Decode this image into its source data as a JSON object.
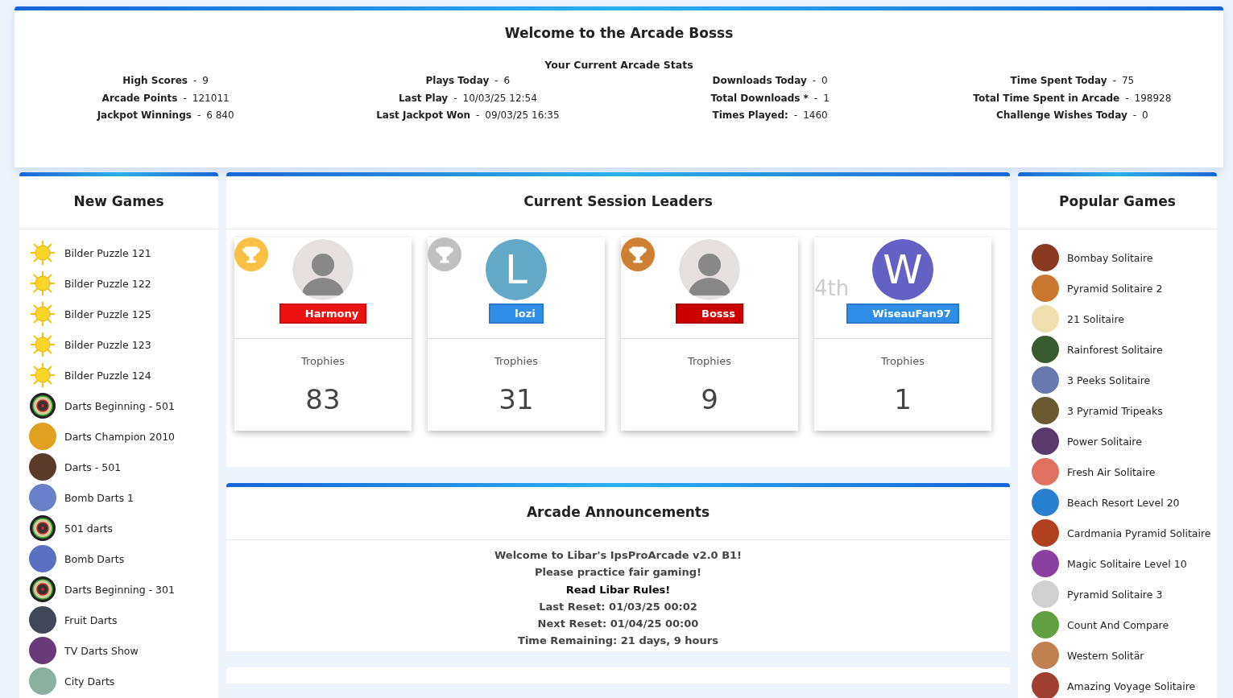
{
  "header": {
    "title": "Welcome to the Arcade Bosss",
    "subtitle": "Your Current Arcade Stats",
    "separator": "-",
    "columns": [
      [
        {
          "label": "High Scores",
          "value": "9"
        },
        {
          "label": "Arcade Points",
          "value": "121011"
        },
        {
          "label": "Jackpot Winnings",
          "value": "6 840"
        }
      ],
      [
        {
          "label": "Plays Today",
          "value": "6"
        },
        {
          "label": "Last Play",
          "value": "10/03/25 12:54"
        },
        {
          "label": "Last Jackpot Won",
          "value": "09/03/25 16:35"
        }
      ],
      [
        {
          "label": "Downloads Today",
          "value": "0"
        },
        {
          "label": "Total Downloads *",
          "value": "1"
        },
        {
          "label": "Times Played:",
          "value": "1460"
        }
      ],
      [
        {
          "label": "Time Spent Today",
          "value": "75"
        },
        {
          "label": "Total Time Spent in Arcade",
          "value": "198928"
        },
        {
          "label": "Challenge Wishes Today",
          "value": "0"
        }
      ]
    ]
  },
  "new_games": {
    "title": "New Games",
    "items": [
      {
        "name": "Bilder Puzzle 121",
        "kind": "sun"
      },
      {
        "name": "Bilder Puzzle 122",
        "kind": "sun"
      },
      {
        "name": "Bilder Puzzle 125",
        "kind": "sun"
      },
      {
        "name": "Bilder Puzzle 123",
        "kind": "sun"
      },
      {
        "name": "Bilder Puzzle 124",
        "kind": "sun"
      },
      {
        "name": "Darts Beginning - 501",
        "kind": "dartboard"
      },
      {
        "name": "Darts Champion 2010",
        "kind": "picture",
        "color": "#e0a020"
      },
      {
        "name": "Darts - 501",
        "kind": "picture",
        "color": "#5a3a2a"
      },
      {
        "name": "Bomb Darts 1",
        "kind": "picture",
        "color": "#6a80c8"
      },
      {
        "name": "501 darts",
        "kind": "dartboard"
      },
      {
        "name": "Bomb Darts",
        "kind": "picture",
        "color": "#5a70c0"
      },
      {
        "name": "Darts Beginning - 301",
        "kind": "dartboard"
      },
      {
        "name": "Fruit Darts",
        "kind": "picture",
        "color": "#404858"
      },
      {
        "name": "TV Darts Show",
        "kind": "picture",
        "color": "#6a3a7a"
      },
      {
        "name": "City Darts",
        "kind": "picture",
        "color": "#8ab0a0"
      }
    ]
  },
  "leaders": {
    "title": "Current Session Leaders",
    "items": [
      {
        "rank": {
          "kind": "trophy",
          "color": "#f8c146"
        },
        "avatar": {
          "kind": "photo"
        },
        "name": "Harmony",
        "color": "#ee1111",
        "stat_label": "Trophies",
        "stat": "83"
      },
      {
        "rank": {
          "kind": "trophy",
          "color": "#c0c0c0"
        },
        "avatar": {
          "kind": "letter",
          "letter": "L",
          "color": "#65a9c8"
        },
        "name": "lozi",
        "color": "#2f8fe8",
        "stat_label": "Trophies",
        "stat": "31"
      },
      {
        "rank": {
          "kind": "trophy",
          "color": "#cd7f32"
        },
        "avatar": {
          "kind": "photo"
        },
        "name": "Bosss",
        "color": "#cc0000",
        "stat_label": "Trophies",
        "stat": "9"
      },
      {
        "rank": {
          "kind": "text",
          "label": "4th"
        },
        "avatar": {
          "kind": "letter",
          "letter": "W",
          "color": "#6560c4"
        },
        "name": "WiseauFan97",
        "color": "#2f8fe8",
        "stat_label": "Trophies",
        "stat": "1"
      }
    ]
  },
  "announcements": {
    "title": "Arcade Announcements",
    "lines": [
      {
        "text": "Welcome to Libar's IpsProArcade v2.0 B1!",
        "kind": "text"
      },
      {
        "text": "Please practice fair gaming!",
        "kind": "text"
      },
      {
        "text": "Read Libar Rules!",
        "kind": "link"
      },
      {
        "text": "Last Reset: 01/03/25 00:02",
        "kind": "text"
      },
      {
        "text": "Next Reset: 01/04/25 00:00",
        "kind": "text"
      },
      {
        "text": "Time Remaining: 21 days, 9 hours",
        "kind": "text"
      }
    ]
  },
  "popular_games": {
    "title": "Popular Games",
    "items": [
      {
        "name": "Bombay Solitaire",
        "color": "#8a3a20"
      },
      {
        "name": "Pyramid Solitaire 2",
        "color": "#c87830"
      },
      {
        "name": "21 Solitaire",
        "color": "#f0e0b0"
      },
      {
        "name": "Rainforest Solitaire",
        "color": "#3a5a30"
      },
      {
        "name": "3 Peeks Solitaire",
        "color": "#6a7ab0"
      },
      {
        "name": "3 Pyramid Tripeaks",
        "color": "#6a5a30"
      },
      {
        "name": "Power Solitaire",
        "color": "#5a3a6a"
      },
      {
        "name": "Fresh Air Solitaire",
        "color": "#e07060"
      },
      {
        "name": "Beach Resort Level 20",
        "color": "#2a80d0"
      },
      {
        "name": "Cardmania Pyramid Solitaire",
        "color": "#b04020"
      },
      {
        "name": "Magic Solitaire Level 10",
        "color": "#8a40a0"
      },
      {
        "name": "Pyramid Solitaire 3",
        "color": "#d0d0d0"
      },
      {
        "name": "Count And Compare",
        "color": "#60a040"
      },
      {
        "name": "Western Solitär",
        "color": "#c08050"
      },
      {
        "name": "Amazing Voyage Solitaire",
        "color": "#a04030"
      }
    ]
  }
}
